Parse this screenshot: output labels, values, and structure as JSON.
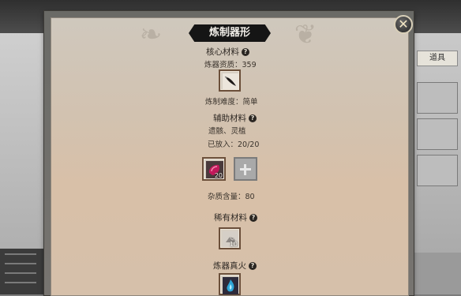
{
  "dialog": {
    "title": "炼制器形",
    "close_symbol": "✕"
  },
  "core": {
    "heading": "核心材料",
    "help": "?",
    "quality_text": "炼器资质：359",
    "difficulty_text": "炼制难度：简单",
    "slot_icon": "brush-blade-icon"
  },
  "auxiliary": {
    "heading": "辅助材料",
    "help": "?",
    "materials_text": "遗骸、灵植",
    "placed_text": "已放入：20/20",
    "slot_count": "20",
    "slot_icon": "red-crystal-icon",
    "add_symbol": "+",
    "impurity_text": "杂质含量：80"
  },
  "rare": {
    "heading": "稀有材料",
    "help": "?",
    "slot_count": "10",
    "slot_icon": "ore-icon"
  },
  "fire": {
    "heading": "炼器真火",
    "help": "?",
    "slot_icon": "blue-flame-icon"
  },
  "background_ui": {
    "right_tab_label": "道具"
  },
  "colors": {
    "banner": "#151515",
    "slot_border": "#6b4f3a",
    "crystal": "#c2185b",
    "flame": "#2fa7d8"
  }
}
